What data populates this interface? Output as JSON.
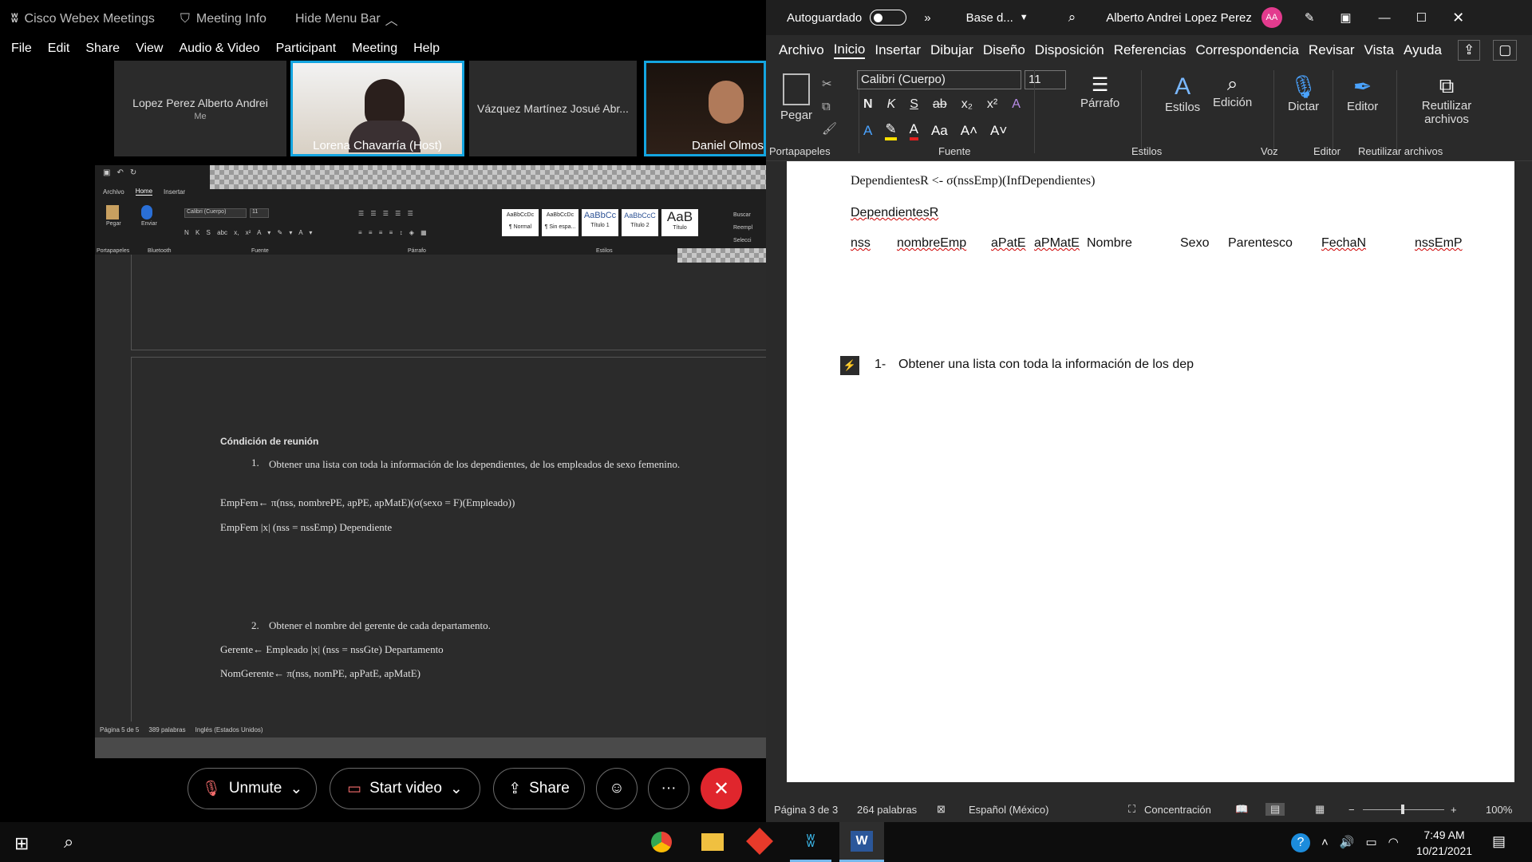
{
  "webex": {
    "app_name": "Cisco Webex Meetings",
    "meeting_info": "Meeting Info",
    "hide_menu_bar": "Hide Menu Bar",
    "menu": [
      "File",
      "Edit",
      "Share",
      "View",
      "Audio & Video",
      "Participant",
      "Meeting",
      "Help"
    ],
    "participants": [
      {
        "name": "Lopez Perez Alberto Andrei",
        "sub": "Me"
      },
      {
        "name": "Lorena Chavarría  (Host)"
      },
      {
        "name": "Vázquez Martínez Josué Abr..."
      },
      {
        "name": "Daniel Olmos"
      }
    ],
    "controls": {
      "unmute": "Unmute",
      "start_video": "Start video",
      "share": "Share",
      "more": "···"
    }
  },
  "shared_doc": {
    "tabs": [
      "Archivo",
      "Home",
      "Insertar"
    ],
    "font": "Calibri (Cuerpo)",
    "size": "11",
    "groups": [
      "Portapapeles",
      "Bluetooth",
      "Fuente",
      "Párrafo",
      "Estilos"
    ],
    "buttons": {
      "paste": "Pegar",
      "send": "Enviar",
      "find": "Buscar",
      "replace": "Reempl",
      "select": "Selecci"
    },
    "styles": [
      {
        "sample": "AaBbCcDc",
        "name": "¶ Normal"
      },
      {
        "sample": "AaBbCcDc",
        "name": "¶ Sin espa..."
      },
      {
        "sample": "AaBbCc",
        "name": "Título 1"
      },
      {
        "sample": "AaBbCcC",
        "name": "Título 2"
      },
      {
        "sample": "AaB",
        "name": "Título"
      }
    ],
    "heading": "Cóndición de reunión",
    "item1": "Obtener una lista con toda la información de los dependientes, de los empleados de sexo femenino.",
    "item1_num": "1.",
    "line1": "EmpFem← π(nss, nombrePE, apPE, apMatE)(σ(sexo = F)(Empleado))",
    "line2": "EmpFem |x| (nss = nssEmp) Dependiente",
    "item2_num": "2.",
    "item2": "Obtener el nombre del gerente de cada departamento.",
    "line3": "Gerente← Empleado |x| (nss = nssGte) Departamento",
    "line4": "NomGerente← π(nss, nomPE, apPatE, apMatE)",
    "status": {
      "page": "Página 5 de 5",
      "words": "389 palabras",
      "lang": "Inglés (Estados Unidos)"
    }
  },
  "word": {
    "autosave": "Autoguardado",
    "doc_name": "Base d...",
    "user": "Alberto Andrei Lopez Perez",
    "initials": "AA",
    "tabs": [
      "Archivo",
      "Inicio",
      "Insertar",
      "Dibujar",
      "Diseño",
      "Disposición",
      "Referencias",
      "Correspondencia",
      "Revisar",
      "Vista",
      "Ayuda"
    ],
    "font": "Calibri (Cuerpo)",
    "size": "11",
    "buttons": {
      "paste": "Pegar",
      "paragraph": "Párrafo",
      "styles": "Estilos",
      "editing": "Edición",
      "dictate": "Dictar",
      "editor": "Editor",
      "reuse": "Reutilizar archivos"
    },
    "groups": [
      "Portapapeles",
      "Fuente",
      "Estilos",
      "Voz",
      "Editor",
      "Reutilizar archivos"
    ],
    "fmt": [
      "N",
      "K",
      "S",
      "ab",
      "x₂",
      "x²"
    ],
    "line1": "DependientesR <- σ(nssEmp)(InfDependientes)",
    "line2": "DependientesR",
    "columns": [
      "nss",
      "nombreEmp",
      "aPatE",
      "aPMatE",
      "Nombre",
      "Sexo",
      "Parentesco",
      "FechaN",
      "nssEmP"
    ],
    "list_num": "1-",
    "list_text": "Obtener una lista con toda la información de los dep",
    "status": {
      "page": "Página 3 de 3",
      "words": "264 palabras",
      "lang": "Español (México)",
      "focus": "Concentración",
      "zoom": "100%"
    }
  },
  "taskbar": {
    "time": "7:49 AM",
    "date": "10/21/2021"
  }
}
